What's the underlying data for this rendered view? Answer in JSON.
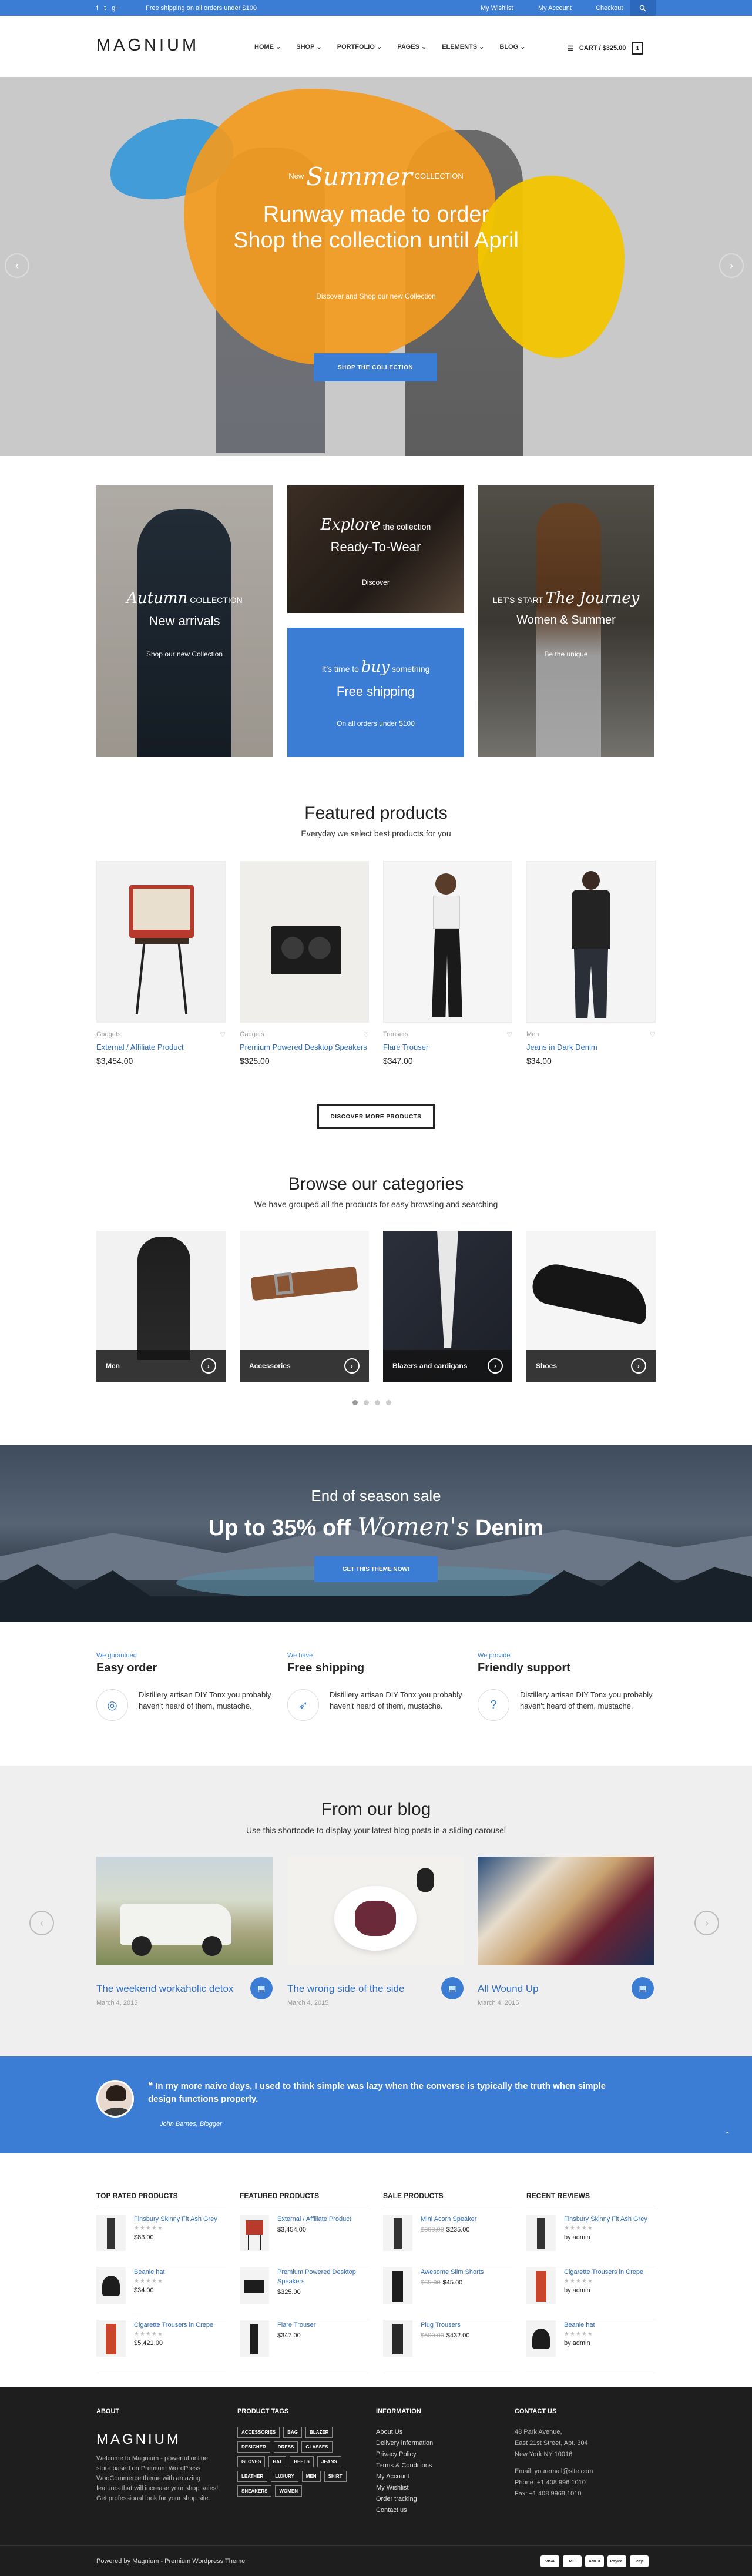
{
  "topbar": {
    "shipping_text": "Free shipping on all orders under $100",
    "wishlist": "My Wishlist",
    "account": "My Account",
    "checkout": "Checkout",
    "social_icons": [
      "facebook-icon",
      "twitter-icon",
      "google-plus-icon"
    ]
  },
  "header": {
    "logo": "MAGNIUM",
    "nav": [
      "HOME",
      "SHOP",
      "PORTFOLIO",
      "PAGES",
      "ELEMENTS",
      "BLOG"
    ],
    "cart_label": "CART / $325.00",
    "cart_count": "1"
  },
  "hero": {
    "sub_pre": "New",
    "sub_script": "Summer",
    "sub_post": "COLLECTION",
    "title_line1": "Runway made to order",
    "title_line2": "Shop the collection until April",
    "description": "Discover and Shop our new Collection",
    "button": "SHOP THE COLLECTION",
    "colors": {
      "blue": "#3a9ad9",
      "orange": "#f39a1e",
      "yellow": "#f2c500"
    }
  },
  "banners": [
    {
      "script": "Autumn",
      "pre": "",
      "post": "COLLECTION",
      "title": "New arrivals",
      "sub": "Shop our new Collection"
    },
    {
      "script": "Explore",
      "pre": "",
      "post": "the collection",
      "title": "Ready-To-Wear",
      "sub": "Discover"
    },
    {
      "script": "buy",
      "pre": "It's time to",
      "post": "something",
      "title": "Free shipping",
      "sub": "On all orders under $100"
    },
    {
      "script": "The Journey",
      "pre": "LET'S START",
      "post": "",
      "title": "Women & Summer",
      "sub": "Be the unique"
    }
  ],
  "featured": {
    "title": "Featured products",
    "subtitle": "Everyday we select best products for you",
    "products": [
      {
        "category": "Gadgets",
        "name": "External / Affiliate Product",
        "price": "$3,454.00"
      },
      {
        "category": "Gadgets",
        "name": "Premium Powered Desktop Speakers",
        "price": "$325.00"
      },
      {
        "category": "Trousers",
        "name": "Flare Trouser",
        "price": "$347.00"
      },
      {
        "category": "Men",
        "name": "Jeans in Dark Denim",
        "price": "$34.00"
      }
    ],
    "button": "DISCOVER MORE PRODUCTS"
  },
  "categories": {
    "title": "Browse our categories",
    "subtitle": "We have grouped all the products for easy browsing and searching",
    "items": [
      "Men",
      "Accessories",
      "Blazers and cardigans",
      "Shoes"
    ]
  },
  "sale": {
    "line1": "End of season sale",
    "line2_pre": "Up to 35% off",
    "line2_script": "Women's",
    "line2_post": "Denim",
    "button": "GET THIS THEME NOW!"
  },
  "features": [
    {
      "pre": "We gurantued",
      "title": "Easy order",
      "text": "Distillery artisan DIY Tonx you probably haven't heard of them, mustache.",
      "icon": "life-ring-icon"
    },
    {
      "pre": "We have",
      "title": "Free shipping",
      "text": "Distillery artisan DIY Tonx you probably haven't heard of them, mustache.",
      "icon": "rocket-icon"
    },
    {
      "pre": "We provide",
      "title": "Friendly support",
      "text": "Distillery artisan DIY Tonx you probably haven't heard of them, mustache.",
      "icon": "question-icon"
    }
  ],
  "blog": {
    "title": "From our blog",
    "subtitle": "Use this shortcode to display your latest blog posts in a sliding carousel",
    "posts": [
      {
        "title": "The weekend workaholic detox",
        "date": "March 4, 2015"
      },
      {
        "title": "The wrong side of the side",
        "date": "March 4, 2015"
      },
      {
        "title": "All Wound Up",
        "date": "March 4, 2015"
      }
    ]
  },
  "testimonial": {
    "quote": "In my more naive days, I used to think simple was lazy when the converse is typically the truth when simple design functions properly.",
    "author": "John Barnes, Blogger"
  },
  "widgets": {
    "top_rated": {
      "title": "TOP RATED PRODUCTS",
      "items": [
        {
          "name": "Finsbury Skinny Fit Ash Grey",
          "stars": "★★★★★",
          "price": "$83.00",
          "old": ""
        },
        {
          "name": "Beanie hat",
          "stars": "★★★★★",
          "price": "$34.00",
          "old": ""
        },
        {
          "name": "Cigarette Trousers in Crepe",
          "stars": "★★★★★",
          "price": "$5,421.00",
          "old": ""
        }
      ]
    },
    "featured": {
      "title": "FEATURED PRODUCTS",
      "items": [
        {
          "name": "External / Affiliate Product",
          "stars": "",
          "price": "$3,454.00",
          "old": ""
        },
        {
          "name": "Premium Powered Desktop Speakers",
          "stars": "",
          "price": "$325.00",
          "old": ""
        },
        {
          "name": "Flare Trouser",
          "stars": "",
          "price": "$347.00",
          "old": ""
        }
      ]
    },
    "sale": {
      "title": "SALE PRODUCTS",
      "items": [
        {
          "name": "Mini Acorn Speaker",
          "stars": "",
          "price": "$235.00",
          "old": "$300.00"
        },
        {
          "name": "Awesome Slim Shorts",
          "stars": "",
          "price": "$45.00",
          "old": "$65.00"
        },
        {
          "name": "Plug Trousers",
          "stars": "",
          "price": "$432.00",
          "old": "$500.00"
        }
      ]
    },
    "reviews": {
      "title": "RECENT REVIEWS",
      "items": [
        {
          "name": "Finsbury Skinny Fit Ash Grey",
          "stars": "★★★★★",
          "by": "by admin"
        },
        {
          "name": "Cigarette Trousers in Crepe",
          "stars": "★★★★★",
          "by": "by admin"
        },
        {
          "name": "Beanie hat",
          "stars": "★★★★★",
          "by": "by admin"
        }
      ]
    }
  },
  "footer": {
    "about_title": "ABOUT",
    "logo": "MAGNIUM",
    "about_text": "Welcome to Magnium - powerful online store based on Premium WordPress WooCommerce theme with amazing features that will increase your shop sales! Get professional look for your shop site.",
    "tags_title": "PRODUCT TAGS",
    "tags": [
      "ACCESSORIES",
      "BAG",
      "BLAZER",
      "DESIGNER",
      "DRESS",
      "GLASSES",
      "GLOVES",
      "HAT",
      "HEELS",
      "JEANS",
      "LEATHER",
      "LUXURY",
      "MEN",
      "SHIRT",
      "SNEAKERS",
      "WOMEN"
    ],
    "info_title": "INFORMATION",
    "info_links": [
      "About Us",
      "Delivery information",
      "Privacy Policy",
      "Terms & Conditions",
      "My Account",
      "My Wishlist",
      "Order tracking",
      "Contact us"
    ],
    "contact_title": "CONTACT US",
    "contact_lines": [
      "48 Park Avenue,",
      "East 21st Street, Apt. 304",
      "New York NY 10016",
      "Email: youremail@site.com",
      "Phone: +1 408 996 1010",
      "Fax: +1 408 9968 1010"
    ],
    "copyright": "Powered by Magnium - Premium Wordpress Theme",
    "payments": [
      "VISA",
      "MC",
      "AMEX",
      "PayPal",
      "Pay"
    ]
  }
}
